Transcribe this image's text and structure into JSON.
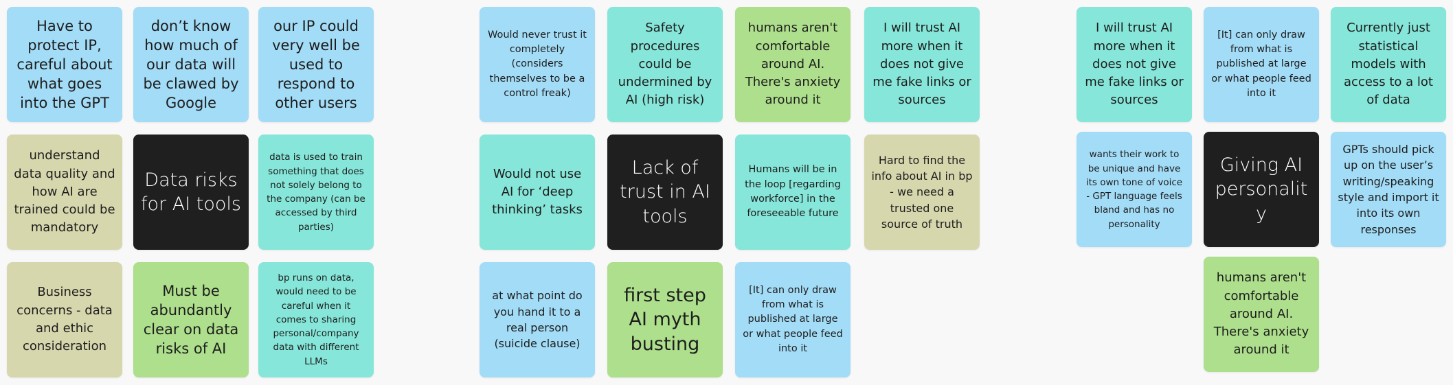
{
  "colors": {
    "canvas": "#f8f8f8",
    "blue": "#a3dcf7",
    "teal": "#86e6d9",
    "green": "#addf8c",
    "khaki": "#d7d7ae",
    "dark": "#1f1f1f"
  },
  "clusters": {
    "data_risks": {
      "title": "Data risks for AI tools",
      "notes": [
        "Have to protect IP, careful about what goes into the GPT",
        "don’t know how much of our data will be clawed by Google",
        "our IP could very well be used to respond to other users",
        "understand data quality and how AI are trained could be mandatory",
        "data is used to train something that does not solely belong to the company (can be accessed by third parties)",
        "Business concerns - data and ethic consideration",
        "Must be abundantly clear on data risks of AI",
        "bp runs on data, would need to be careful when it comes to sharing personal/company data with different LLMs"
      ]
    },
    "lack_of_trust": {
      "title": "Lack of trust in AI tools",
      "notes": [
        "Would never trust it completely (considers themselves to be a control freak)",
        "Safety procedures could be undermined by AI (high risk)",
        "humans aren't comfortable around AI. There's anxiety around it",
        "I will trust AI more when it does not give me fake links or sources",
        "Would not use AI for ‘deep thinking’ tasks",
        "Humans will be in the loop [regarding workforce] in the foreseeable future",
        "Hard to find the info about AI in bp - we need a trusted one source of truth",
        "at what point do you hand it to a real person (suicide clause)",
        "first step AI myth busting",
        "[It] can only draw from what is published at large or what people feed into it"
      ]
    },
    "personality": {
      "title": "Giving AI personality",
      "notes": [
        "I will trust AI more when it does not give me fake links or sources",
        "[It] can only draw from what is published at large or what people feed into it",
        "Currently just statistical models with access to a lot of data",
        "wants their work to be unique and have its own tone of voice - GPT language feels bland and has no personality",
        "GPTs should pick up on the user’s writing/speaking style and import it into its own responses",
        "humans aren't comfortable around AI. There's anxiety around it"
      ]
    }
  }
}
